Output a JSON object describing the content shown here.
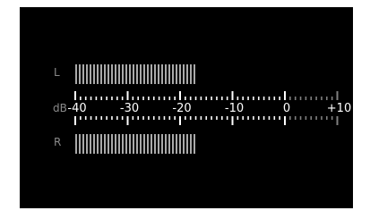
{
  "meter": {
    "channel_left": "L",
    "channel_right": "R",
    "unit": "dB",
    "scale_labels": [
      "-40",
      "-30",
      "-20",
      "-10",
      "0",
      "+10"
    ],
    "left_level_db": -17,
    "right_level_db": -17,
    "colors": {
      "background": "#000000",
      "active_tick": "#ffffff",
      "over_tick": "#808080",
      "level_bar": "#a9a9a9",
      "label": "#8a8a8a"
    }
  }
}
